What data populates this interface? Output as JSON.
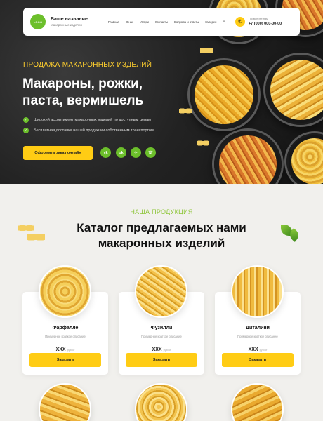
{
  "header": {
    "logo_text": "LOGO",
    "brand_name": "Ваше название",
    "brand_sub": "Макаронные изделия",
    "nav": [
      "Главная",
      "О нас",
      "Услуги",
      "Контакты",
      "Вопросы и ответы",
      "Галерея"
    ],
    "menu_icon": "menu-icon",
    "phone_caption": "Позвоните нам",
    "phone": "+7 (000) 000-00-00"
  },
  "hero": {
    "eyebrow": "ПРОДАЖА МАКАРОННЫХ ИЗДЕЛИЙ",
    "title": "Макароны, рожки, паста, вермишель",
    "bullets": [
      "Широкий ассортимент макаронных изделий по доступным ценам",
      "Бесплатная доставка нашей продукции собственным транспортом"
    ],
    "cta": "Оформить заказ онлайн",
    "social": [
      "vk-icon",
      "odnoklassniki-icon",
      "telegram-icon",
      "whatsapp-icon"
    ],
    "social_glyphs": [
      "vk",
      "ok",
      "✈",
      "☏"
    ]
  },
  "catalog": {
    "eyebrow": "НАША ПРОДУКЦИЯ",
    "title": "Каталог предлагаемых нами макаронных изделий",
    "products": [
      {
        "name": "Фарфалле",
        "desc": "Примерное краткое описание",
        "price": "XXX",
        "unit": "руб/кг",
        "button": "Заказать"
      },
      {
        "name": "Фузилли",
        "desc": "Примерное краткое описание",
        "price": "XXX",
        "unit": "руб/кг",
        "button": "Заказать"
      },
      {
        "name": "Диталини",
        "desc": "Примерное краткое описание",
        "price": "XXX",
        "unit": "руб/кг",
        "button": "Заказать"
      }
    ]
  },
  "colors": {
    "accent_yellow": "#ffcc14",
    "accent_green": "#6cbf2b",
    "dark_bg": "#1c1c1c"
  }
}
